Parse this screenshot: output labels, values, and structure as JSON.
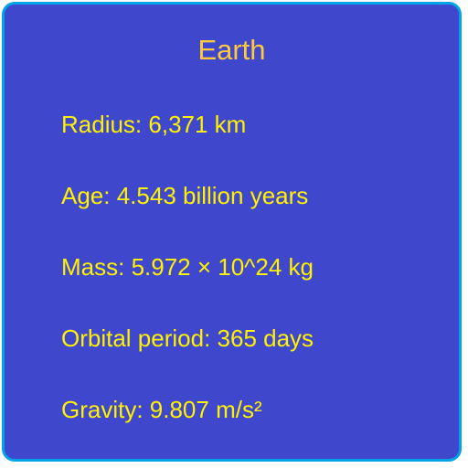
{
  "card": {
    "title": "Earth",
    "facts": [
      "Radius: 6,371 km",
      "Age: 4.543 billion years",
      "Mass: 5.972 × 10^24 kg",
      "Orbital period: 365 days",
      "Gravity: 9.807 m/s²"
    ]
  },
  "colors": {
    "background": "#3f48cc",
    "border": "#00a2e8",
    "title": "#ffc83d",
    "text": "#fff200"
  }
}
